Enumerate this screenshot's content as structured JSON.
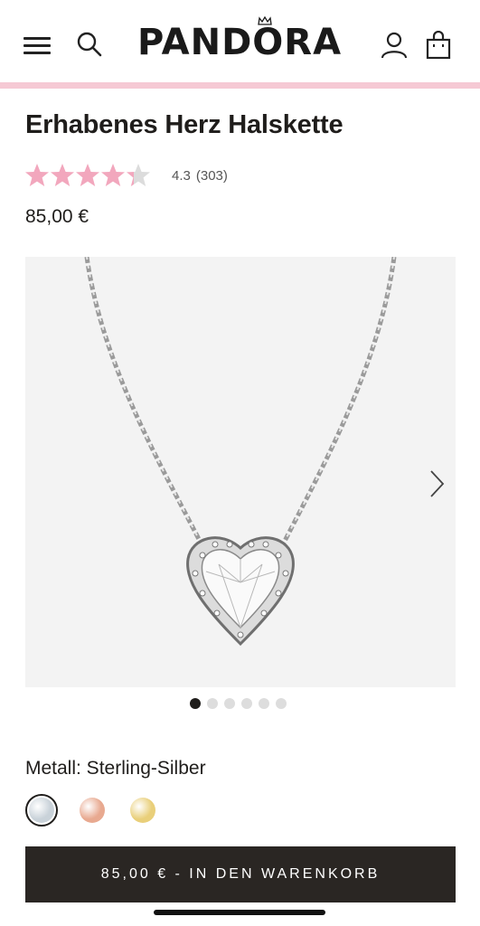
{
  "header": {
    "logo_text": "PANDORA",
    "icons": [
      "menu-icon",
      "search-icon",
      "account-icon",
      "shopping-bag-icon"
    ]
  },
  "product": {
    "title": "Erhabenes Herz Halskette",
    "rating": 4.3,
    "rating_text": "4.3",
    "review_count": "(303)",
    "price": "85,00 €"
  },
  "gallery": {
    "image_count": 6,
    "active_index": 0,
    "next_icon": "chevron-right-icon"
  },
  "options": {
    "metal_label": "Metall: Sterling-Silber",
    "swatches": [
      {
        "name": "Sterling-Silber",
        "color": "#c9d2d9",
        "selected": true
      },
      {
        "name": "Rosé",
        "color": "#e8a990",
        "selected": false
      },
      {
        "name": "Gold",
        "color": "#e9cf7a",
        "selected": false
      }
    ]
  },
  "cta": {
    "label": "85,00 € - IN DEN WARENKORB"
  },
  "colors": {
    "accent_pink": "#f6c9d4",
    "star_filled": "#f2a7bd",
    "star_empty": "#dcdcdc",
    "button_bg": "#2a2623"
  }
}
